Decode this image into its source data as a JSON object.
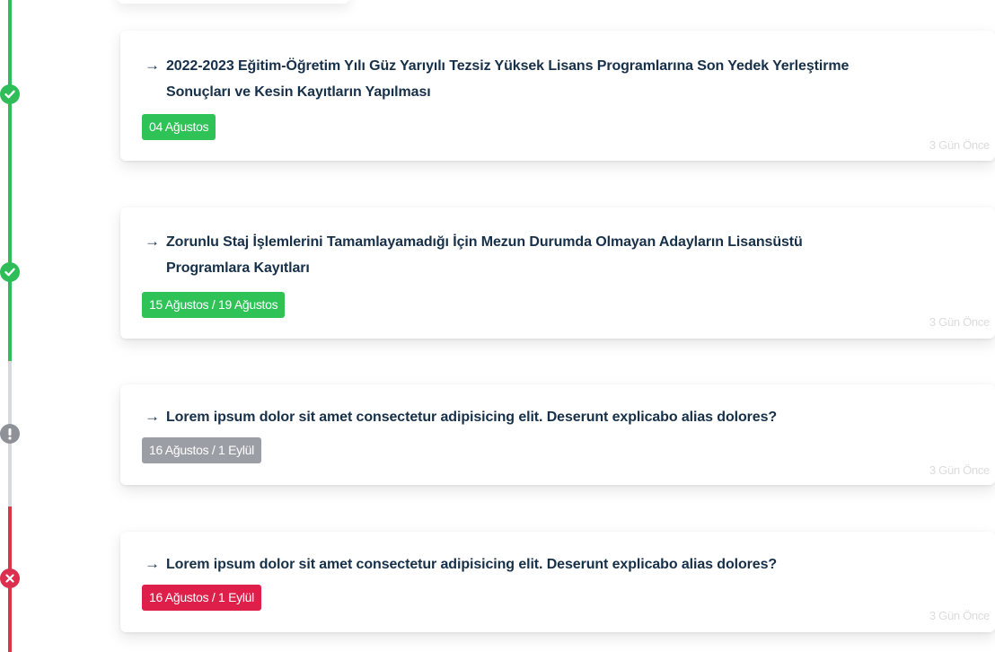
{
  "items": [
    {
      "arrow": "→",
      "title_line1": "2022-2023 Eğitim-Öğretim Yılı Güz Yarıyılı Tezsiz Yüksek Lisans Programlarına Son Yedek Yerleştirme",
      "title_line2": "Sonuçları ve Kesin Kayıtların Yapılması",
      "date": "04 Ağustos",
      "ago": "3 Gün Önce",
      "status": "success",
      "status_icon": "check-icon"
    },
    {
      "arrow": "→",
      "title_line1": "Zorunlu Staj İşlemlerini Tamamlayamadığı İçin Mezun Durumda Olmayan Adayların Lisansüstü",
      "title_line2": "Programlara Kayıtları",
      "date": "15 Ağustos / 19 Ağustos",
      "ago": "3 Gün Önce",
      "status": "success",
      "status_icon": "check-icon"
    },
    {
      "arrow": "→",
      "title_line1": "Lorem ipsum dolor sit amet consectetur adipisicing elit. Deserunt explicabo alias dolores?",
      "date": "16 Ağustos / 1 Eylül",
      "ago": "3 Gün Önce",
      "status": "pending",
      "status_icon": "exclamation-icon"
    },
    {
      "arrow": "→",
      "title_line1": "Lorem ipsum dolor sit amet consectetur adipisicing elit. Deserunt explicabo alias dolores?",
      "date": "16 Ağustos / 1 Eylül",
      "ago": "3 Gün Önce",
      "status": "failed",
      "status_icon": "x-icon"
    }
  ],
  "colors": {
    "success": "#2ebd58",
    "pending": "#8e9298",
    "failed": "#dc2e4f",
    "title": "#173049"
  }
}
